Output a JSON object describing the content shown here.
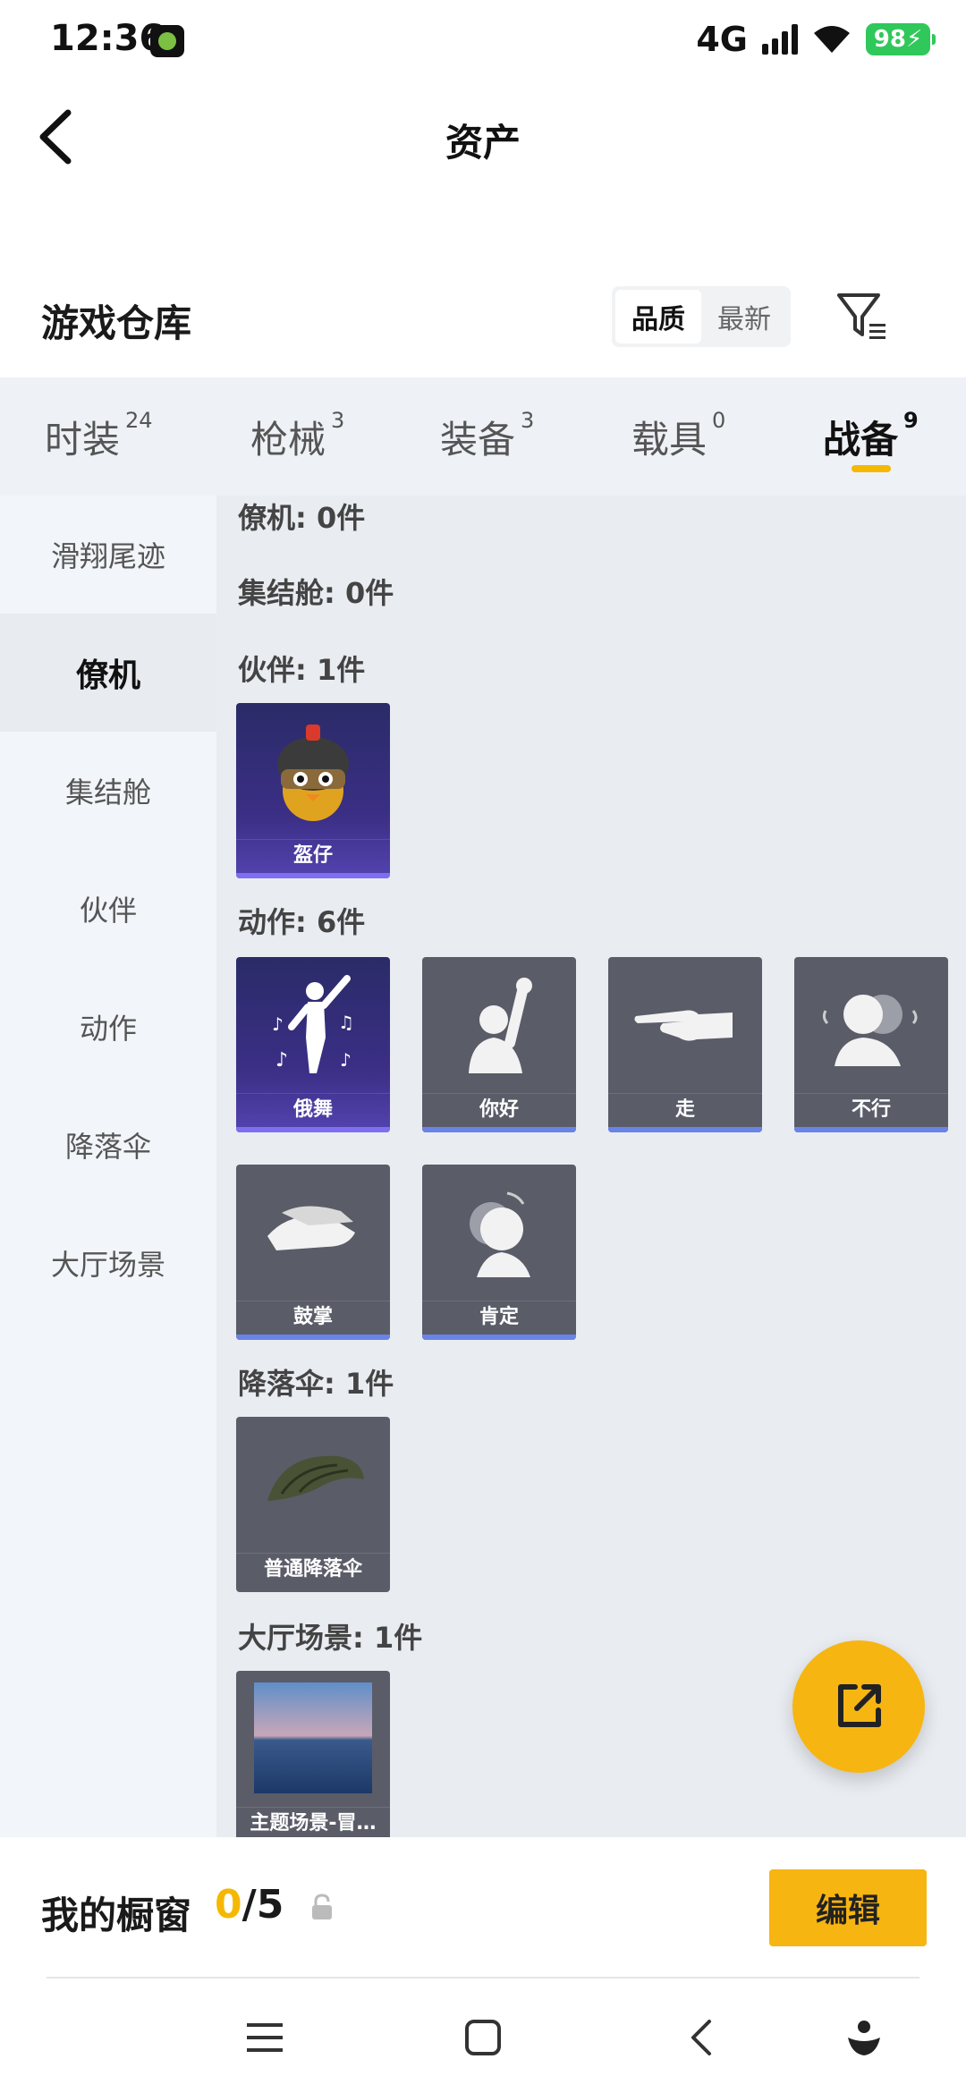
{
  "status": {
    "time": "12:36",
    "network": "4G",
    "battery": "98"
  },
  "header": {
    "title": "资产"
  },
  "section": {
    "title": "游戏仓库",
    "sort_options": [
      "品质",
      "最新"
    ],
    "sort_active": "品质"
  },
  "tabs": [
    {
      "label": "时装",
      "count": "24"
    },
    {
      "label": "枪械",
      "count": "3"
    },
    {
      "label": "装备",
      "count": "3"
    },
    {
      "label": "载具",
      "count": "0"
    },
    {
      "label": "战备",
      "count": "9",
      "active": true
    }
  ],
  "sidebar": [
    {
      "label": "滑翔尾迹"
    },
    {
      "label": "僚机",
      "active": true
    },
    {
      "label": "集结舱"
    },
    {
      "label": "伙伴"
    },
    {
      "label": "动作"
    },
    {
      "label": "降落伞"
    },
    {
      "label": "大厅场景"
    }
  ],
  "groups": {
    "wingman": "僚机: 0件",
    "capsule": "集结舱: 0件",
    "partner": "伙伴: 1件",
    "emote": "动作: 6件",
    "parachute": "降落伞: 1件",
    "lobby": "大厅场景: 1件"
  },
  "items": {
    "partner": [
      {
        "name": "盔仔",
        "icon": "chick-helmet-icon"
      }
    ],
    "emote": [
      {
        "name": "俄舞",
        "icon": "dance-icon"
      },
      {
        "name": "你好",
        "icon": "wave-icon"
      },
      {
        "name": "走",
        "icon": "point-icon"
      },
      {
        "name": "不行",
        "icon": "shake-head-icon"
      },
      {
        "name": "鼓掌",
        "icon": "clap-icon"
      },
      {
        "name": "肯定",
        "icon": "nod-icon"
      }
    ],
    "parachute": [
      {
        "name": "普通降落伞",
        "icon": "parachute-icon"
      }
    ],
    "lobby": [
      {
        "name": "主题场景-冒…",
        "icon": "scene-icon"
      }
    ]
  },
  "bottom": {
    "label": "我的橱窗",
    "current": "0",
    "total": "/5",
    "edit_label": "编辑"
  },
  "colors": {
    "accent": "#f5b800",
    "purple_card": "#3b2f86",
    "grey_card": "#5a5c68",
    "card_bar": "#6a83e6"
  }
}
